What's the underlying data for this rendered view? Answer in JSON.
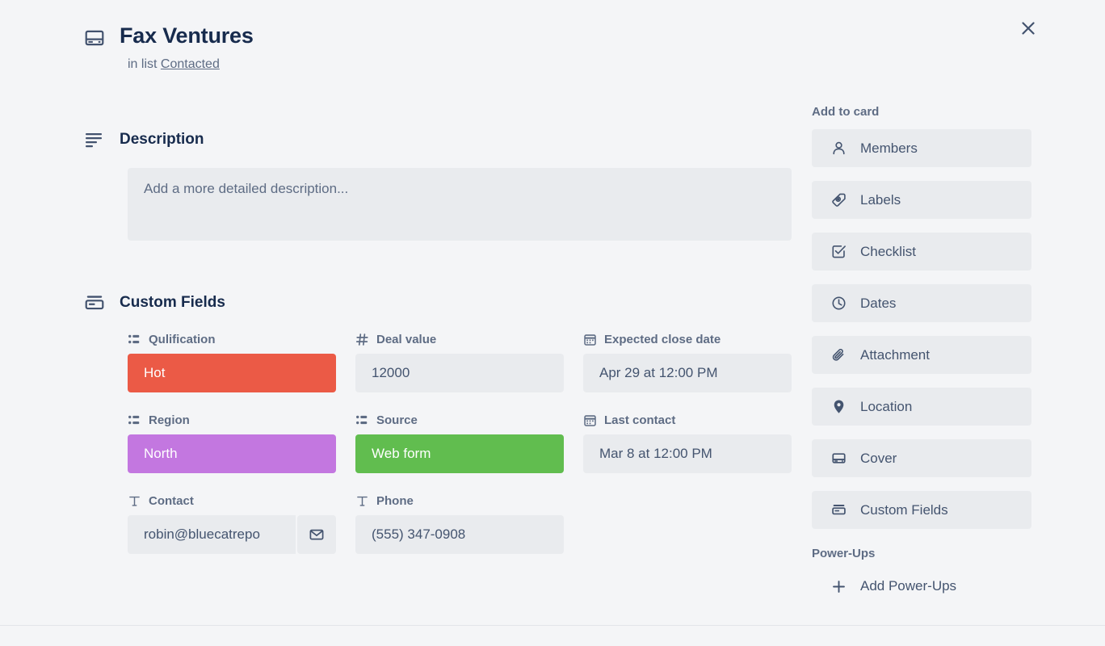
{
  "window": {
    "close_label": "×"
  },
  "card": {
    "icon": "cover-card-icon",
    "title": "Fax Ventures",
    "in_list_prefix": "in list",
    "list_name": "Contacted"
  },
  "description": {
    "icon": "description-lines-icon",
    "heading": "Description",
    "placeholder": "Add a more detailed description..."
  },
  "custom_fields": {
    "icon": "custom-fields-icon",
    "heading": "Custom Fields",
    "fields": [
      {
        "label": "Qulification",
        "icon": "dropdown-list-icon",
        "type": "dropdown",
        "value": "Hot",
        "chip": true,
        "color": "#eb5a46"
      },
      {
        "label": "Deal value",
        "icon": "number-hash-icon",
        "type": "number",
        "value": "12000",
        "chip": false,
        "color": "#e9ebee"
      },
      {
        "label": "Expected close date",
        "icon": "calendar-icon",
        "type": "date",
        "value": "Apr 29 at 12:00 PM",
        "chip": false,
        "color": "#e9ebee"
      },
      {
        "label": "Region",
        "icon": "dropdown-list-icon",
        "type": "dropdown",
        "value": "North",
        "chip": true,
        "color": "#c377e0"
      },
      {
        "label": "Source",
        "icon": "dropdown-list-icon",
        "type": "dropdown",
        "value": "Web form",
        "chip": true,
        "color": "#61bd4f"
      },
      {
        "label": "Last contact",
        "icon": "calendar-icon",
        "type": "date",
        "value": "Mar 8 at 12:00 PM",
        "chip": false,
        "color": "#e9ebee"
      },
      {
        "label": "Contact",
        "icon": "text-field-icon",
        "type": "text",
        "value": "robin@bluecatrepo",
        "chip": false,
        "color": "#e9ebee",
        "action_icon": "envelope-icon"
      },
      {
        "label": "Phone",
        "icon": "text-field-icon",
        "type": "text",
        "value": "(555) 347-0908",
        "chip": false,
        "color": "#e9ebee"
      }
    ]
  },
  "sidebar": {
    "add_to_card_heading": "Add to card",
    "items": [
      {
        "label": "Members",
        "icon": "person-icon"
      },
      {
        "label": "Labels",
        "icon": "label-tag-icon"
      },
      {
        "label": "Checklist",
        "icon": "checkbox-checked-icon"
      },
      {
        "label": "Dates",
        "icon": "clock-icon"
      },
      {
        "label": "Attachment",
        "icon": "paperclip-icon"
      },
      {
        "label": "Location",
        "icon": "map-pin-icon"
      },
      {
        "label": "Cover",
        "icon": "cover-card-icon"
      },
      {
        "label": "Custom Fields",
        "icon": "custom-fields-icon"
      }
    ],
    "powerups_heading": "Power-Ups",
    "add_powerups_label": "Add Power-Ups",
    "add_powerups_icon": "plus-icon"
  },
  "theme": {
    "background": "#f4f5f7",
    "field_background": "#e9ebee",
    "text_primary": "#172b4d",
    "text_muted": "#5e6c84",
    "chip_red": "#eb5a46",
    "chip_purple": "#c377e0",
    "chip_green": "#61bd4f"
  }
}
